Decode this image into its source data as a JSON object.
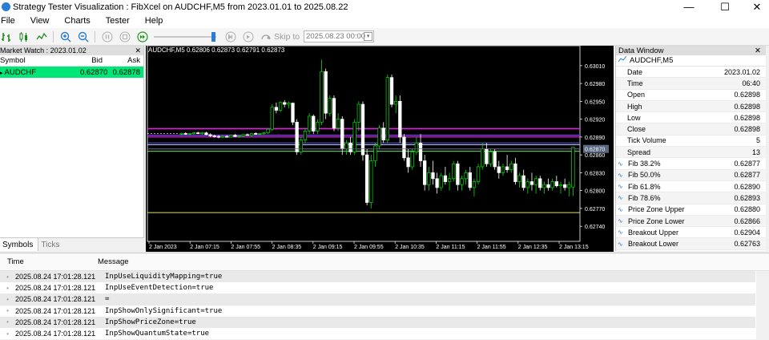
{
  "window": {
    "title": "Strategy Tester Visualization : FibXcel on AUDCHF,M5 from 2023.01.01 to 2025.08.22",
    "minimize_glyph": "—",
    "maximize_glyph": "☐",
    "close_glyph": "✕"
  },
  "menu": [
    "File",
    "View",
    "Charts",
    "Tester",
    "Help"
  ],
  "toolbar": {
    "skip_to_label": "Skip to",
    "skip_date": "2025.08.23 00:00"
  },
  "market_watch": {
    "title": "Market Watch : 2023.01.02",
    "close_glyph": "✕",
    "columns": {
      "symbol": "Symbol",
      "bid": "Bid",
      "ask": "Ask"
    },
    "rows": [
      {
        "symbol": "AUDCHF",
        "bid": "0.62870",
        "ask": "0.62878"
      }
    ],
    "tabs": [
      "Symbols",
      "Ticks"
    ]
  },
  "chart": {
    "label": "AUDCHF,M5  0.62806 0.62873 0.62791 0.62873",
    "price_labels": [
      "0.63010",
      "0.62980",
      "0.62950",
      "0.62920",
      "0.62890",
      "0.62860",
      "0.62830",
      "0.62800",
      "0.62770",
      "0.62740"
    ],
    "current_price": "0.62870",
    "time_labels": [
      "2 Jan 2023",
      "2 Jan 07:15",
      "2 Jan 07:55",
      "2 Jan 08:35",
      "2 Jan 09:15",
      "2 Jan 09:55",
      "2 Jan 10:35",
      "2 Jan 11:15",
      "2 Jan 11:55",
      "2 Jan 12:35",
      "2 Jan 13:15"
    ],
    "colors": {
      "bull": "#00e000",
      "bear": "#ffffff",
      "bg": "#000000"
    }
  },
  "chart_data": {
    "type": "candlestick",
    "symbol": "AUDCHF",
    "timeframe": "M5",
    "ylim": [
      0.6272,
      0.6303
    ],
    "candles_note_open_close": "approximate OHLC read from chart",
    "candles": [
      [
        0.62895,
        0.62897,
        0.62893,
        0.62896
      ],
      [
        0.62896,
        0.62898,
        0.62894,
        0.62895
      ],
      [
        0.62895,
        0.62897,
        0.62893,
        0.62896
      ],
      [
        0.62896,
        0.62898,
        0.62894,
        0.62897
      ],
      [
        0.62897,
        0.62899,
        0.62895,
        0.62896
      ],
      [
        0.62896,
        0.62898,
        0.62894,
        0.62897
      ],
      [
        0.62897,
        0.62899,
        0.62893,
        0.62894
      ],
      [
        0.62894,
        0.62896,
        0.6289,
        0.62892
      ],
      [
        0.62892,
        0.62894,
        0.62889,
        0.62891
      ],
      [
        0.62891,
        0.62893,
        0.62888,
        0.6289
      ],
      [
        0.6289,
        0.62892,
        0.62888,
        0.62891
      ],
      [
        0.62891,
        0.62893,
        0.62889,
        0.6289
      ],
      [
        0.6289,
        0.62894,
        0.62889,
        0.62893
      ],
      [
        0.62893,
        0.62895,
        0.6289,
        0.62891
      ],
      [
        0.62891,
        0.62893,
        0.62889,
        0.62892
      ],
      [
        0.62892,
        0.62895,
        0.6289,
        0.62894
      ],
      [
        0.62894,
        0.62896,
        0.62892,
        0.62893
      ],
      [
        0.62893,
        0.62897,
        0.62891,
        0.62896
      ],
      [
        0.62896,
        0.62898,
        0.62894,
        0.62895
      ],
      [
        0.62895,
        0.62897,
        0.62893,
        0.62896
      ],
      [
        0.62896,
        0.62898,
        0.62894,
        0.62897
      ],
      [
        0.62897,
        0.62904,
        0.62895,
        0.62903
      ],
      [
        0.62903,
        0.62945,
        0.629,
        0.6294
      ],
      [
        0.6294,
        0.62948,
        0.6293,
        0.62935
      ],
      [
        0.62935,
        0.6295,
        0.62932,
        0.62948
      ],
      [
        0.62948,
        0.62952,
        0.6294,
        0.62945
      ],
      [
        0.62945,
        0.6295,
        0.62938,
        0.62947
      ],
      [
        0.62947,
        0.62948,
        0.6291,
        0.62915
      ],
      [
        0.62915,
        0.6292,
        0.6286,
        0.62865
      ],
      [
        0.62865,
        0.6289,
        0.6286,
        0.62885
      ],
      [
        0.62885,
        0.62905,
        0.6288,
        0.629
      ],
      [
        0.629,
        0.6293,
        0.62895,
        0.62925
      ],
      [
        0.62925,
        0.62928,
        0.62895,
        0.629
      ],
      [
        0.629,
        0.6292,
        0.62895,
        0.62915
      ],
      [
        0.62915,
        0.6302,
        0.6291,
        0.63
      ],
      [
        0.63,
        0.63005,
        0.6292,
        0.6293
      ],
      [
        0.6293,
        0.6296,
        0.62925,
        0.62955
      ],
      [
        0.62955,
        0.6296,
        0.629,
        0.62905
      ],
      [
        0.62905,
        0.6293,
        0.629,
        0.6292
      ],
      [
        0.6292,
        0.62925,
        0.6286,
        0.6287
      ],
      [
        0.6287,
        0.62885,
        0.6286,
        0.6288
      ],
      [
        0.6288,
        0.6289,
        0.6286,
        0.62865
      ],
      [
        0.62865,
        0.6292,
        0.6286,
        0.62915
      ],
      [
        0.62915,
        0.6295,
        0.629,
        0.62945
      ],
      [
        0.62945,
        0.6295,
        0.6285,
        0.6286
      ],
      [
        0.6286,
        0.6287,
        0.62775,
        0.6278
      ],
      [
        0.6278,
        0.6286,
        0.6277,
        0.6285
      ],
      [
        0.6285,
        0.6288,
        0.6284,
        0.62875
      ],
      [
        0.62875,
        0.6291,
        0.6287,
        0.62905
      ],
      [
        0.62905,
        0.62915,
        0.6288,
        0.62885
      ],
      [
        0.62885,
        0.62995,
        0.6288,
        0.6299
      ],
      [
        0.6299,
        0.62995,
        0.6294,
        0.62945
      ],
      [
        0.62945,
        0.6296,
        0.6293,
        0.6295
      ],
      [
        0.6295,
        0.6296,
        0.6288,
        0.6289
      ],
      [
        0.6289,
        0.62895,
        0.6285,
        0.62855
      ],
      [
        0.62855,
        0.6287,
        0.6283,
        0.6284
      ],
      [
        0.6284,
        0.6287,
        0.62835,
        0.62865
      ],
      [
        0.62865,
        0.6289,
        0.6286,
        0.6288
      ],
      [
        0.6288,
        0.62895,
        0.6284,
        0.6285
      ],
      [
        0.6285,
        0.6286,
        0.628,
        0.6281
      ],
      [
        0.6281,
        0.6284,
        0.628,
        0.6283
      ],
      [
        0.6283,
        0.6285,
        0.6281,
        0.6282
      ],
      [
        0.6282,
        0.6283,
        0.62795,
        0.62805
      ],
      [
        0.62805,
        0.6283,
        0.628,
        0.62825
      ],
      [
        0.62825,
        0.6284,
        0.6281,
        0.62815
      ],
      [
        0.62815,
        0.6283,
        0.628,
        0.6282
      ],
      [
        0.6282,
        0.6285,
        0.62815,
        0.62845
      ],
      [
        0.62845,
        0.6285,
        0.628,
        0.6281
      ],
      [
        0.6281,
        0.62825,
        0.628,
        0.6282
      ],
      [
        0.6282,
        0.62835,
        0.6281,
        0.6283
      ],
      [
        0.6283,
        0.6284,
        0.628,
        0.62805
      ],
      [
        0.62805,
        0.6282,
        0.6279,
        0.62815
      ],
      [
        0.62815,
        0.62845,
        0.6281,
        0.6284
      ],
      [
        0.6284,
        0.6288,
        0.62835,
        0.6287
      ],
      [
        0.6287,
        0.6288,
        0.6284,
        0.62845
      ],
      [
        0.62845,
        0.6287,
        0.6284,
        0.62865
      ],
      [
        0.62865,
        0.6287,
        0.62835,
        0.6284
      ],
      [
        0.6284,
        0.6285,
        0.6282,
        0.6283
      ],
      [
        0.6283,
        0.62845,
        0.62825,
        0.6284
      ],
      [
        0.6284,
        0.6286,
        0.6283,
        0.62835
      ],
      [
        0.62835,
        0.6285,
        0.6283,
        0.62845
      ],
      [
        0.62845,
        0.62855,
        0.6281,
        0.62815
      ],
      [
        0.62815,
        0.6283,
        0.62805,
        0.62825
      ],
      [
        0.62825,
        0.62835,
        0.628,
        0.62805
      ],
      [
        0.62805,
        0.6282,
        0.62795,
        0.62815
      ],
      [
        0.62815,
        0.6283,
        0.628,
        0.6281
      ],
      [
        0.6281,
        0.62825,
        0.62795,
        0.6282
      ],
      [
        0.6282,
        0.62825,
        0.628,
        0.62805
      ],
      [
        0.62805,
        0.62815,
        0.62795,
        0.6281
      ],
      [
        0.6281,
        0.6282,
        0.628,
        0.62805
      ],
      [
        0.62805,
        0.6282,
        0.628,
        0.62815
      ],
      [
        0.62815,
        0.62825,
        0.62805,
        0.62808
      ],
      [
        0.62808,
        0.62815,
        0.62795,
        0.6281
      ],
      [
        0.6281,
        0.6282,
        0.628,
        0.62805
      ],
      [
        0.62805,
        0.62815,
        0.6279,
        0.6281
      ],
      [
        0.62806,
        0.62873,
        0.62791,
        0.62873
      ]
    ],
    "levels": [
      {
        "price": 0.62904,
        "color": "#e020e0"
      },
      {
        "price": 0.62893,
        "color": "#8030e0"
      },
      {
        "price": 0.6289,
        "color": "#e040e0"
      },
      {
        "price": 0.6288,
        "color": "#6060ff"
      },
      {
        "price": 0.62877,
        "color": "#c0c0ff"
      },
      {
        "price": 0.6287,
        "color": "#7080a0"
      },
      {
        "price": 0.62866,
        "color": "#70e070"
      },
      {
        "price": 0.62763,
        "color": "#e0e060"
      }
    ]
  },
  "data_window": {
    "title": "Data Window",
    "close_glyph": "✕",
    "symbol": "AUDCHF,M5",
    "rows": [
      {
        "label": "Date",
        "value": "2023.01.02",
        "indicator": false
      },
      {
        "label": "Time",
        "value": "06:40",
        "indicator": false
      },
      {
        "label": "Open",
        "value": "0.62898",
        "indicator": false
      },
      {
        "label": "High",
        "value": "0.62898",
        "indicator": false
      },
      {
        "label": "Low",
        "value": "0.62898",
        "indicator": false
      },
      {
        "label": "Close",
        "value": "0.62898",
        "indicator": false
      },
      {
        "label": "Tick Volume",
        "value": "5",
        "indicator": false
      },
      {
        "label": "Spread",
        "value": "13",
        "indicator": false
      },
      {
        "label": "Fib 38.2%",
        "value": "0.62877",
        "indicator": true
      },
      {
        "label": "Fib 50.0%",
        "value": "0.62877",
        "indicator": true
      },
      {
        "label": "Fib 61.8%",
        "value": "0.62890",
        "indicator": true
      },
      {
        "label": "Fib 78.6%",
        "value": "0.62893",
        "indicator": true
      },
      {
        "label": "Price Zone Upper",
        "value": "0.62880",
        "indicator": true
      },
      {
        "label": "Price Zone Lower",
        "value": "0.62866",
        "indicator": true
      },
      {
        "label": "Breakout Upper",
        "value": "0.62904",
        "indicator": true
      },
      {
        "label": "Breakout Lower",
        "value": "0.62763",
        "indicator": true
      }
    ]
  },
  "journal": {
    "columns": {
      "time": "Time",
      "message": "Message"
    },
    "rows": [
      {
        "time": "2025.08.24 17:01:28.121",
        "message": "InpUseLiquidityMapping=true"
      },
      {
        "time": "2025.08.24 17:01:28.121",
        "message": "InpUseEventDetection=true"
      },
      {
        "time": "2025.08.24 17:01:28.121",
        "message": "="
      },
      {
        "time": "2025.08.24 17:01:28.121",
        "message": "InpShowOnlySignificant=true"
      },
      {
        "time": "2025.08.24 17:01:28.121",
        "message": "InpShowPriceZone=true"
      },
      {
        "time": "2025.08.24 17:01:28.121",
        "message": "InpShowQuantumState=true"
      }
    ]
  }
}
